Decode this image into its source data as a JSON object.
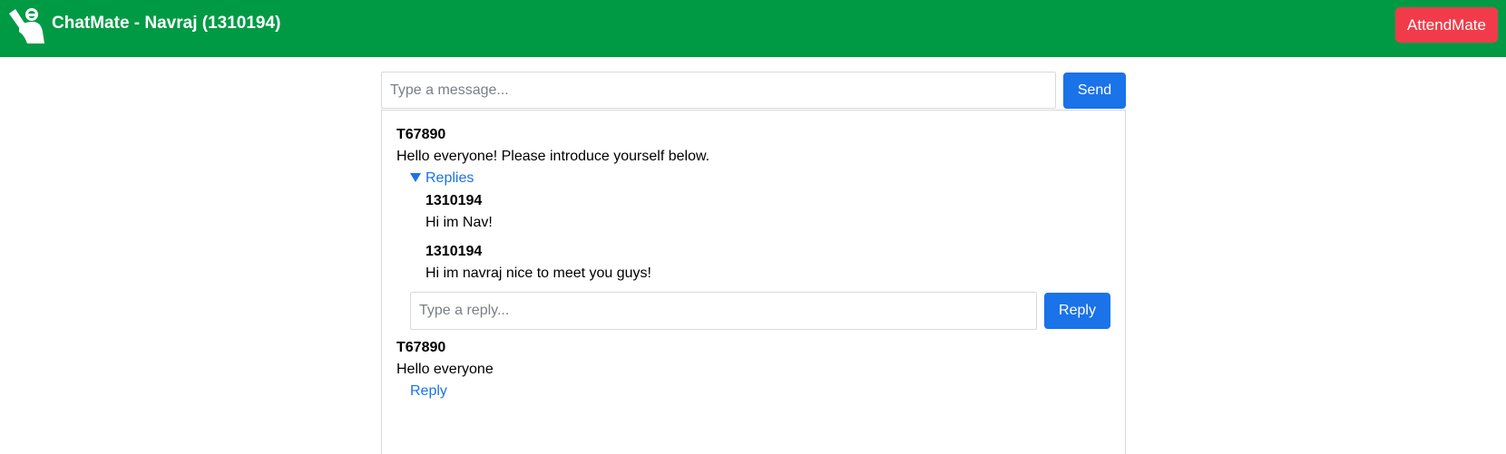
{
  "header": {
    "app_title": "ChatMate - Navraj (1310194)",
    "logo_icon": "waving-person-icon",
    "attend_button_label": "AttendMate",
    "bar_color": "#009a44",
    "attend_button_color": "#f23b4a"
  },
  "composer": {
    "placeholder": "Type a message...",
    "value": "",
    "send_label": "Send"
  },
  "messages": [
    {
      "author": "T67890",
      "text": "Hello everyone! Please introduce yourself below.",
      "replies_toggle_label": "Replies",
      "replies": [
        {
          "author": "1310194",
          "text": "Hi im Nav!"
        },
        {
          "author": "1310194",
          "text": "Hi im navraj nice to meet you guys!"
        }
      ],
      "reply_placeholder": "Type a reply...",
      "reply_button_label": "Reply"
    },
    {
      "author": "T67890",
      "text": "Hello everyone",
      "reply_link_label": "Reply"
    }
  ],
  "accent_color": "#1a73e8"
}
